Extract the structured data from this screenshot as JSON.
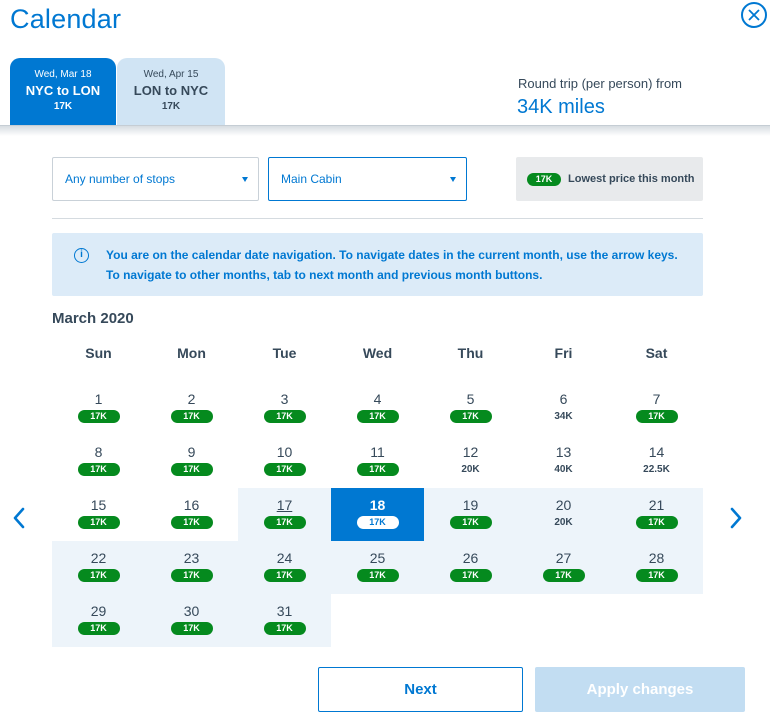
{
  "header": {
    "title": "Calendar",
    "tabs": [
      {
        "date": "Wed, Mar 18",
        "route": "NYC to LON",
        "price": "17K"
      },
      {
        "date": "Wed, Apr 15",
        "route": "LON to NYC",
        "price": "17K"
      }
    ],
    "trip_label": "Round trip (per person) from",
    "trip_price": "34K miles"
  },
  "filters": {
    "stops": "Any number of stops",
    "cabin": "Main Cabin",
    "lowest_badge": "17K",
    "lowest_label": "Lowest price this month"
  },
  "info": "You are on the calendar date navigation. To navigate dates in the current month, use the arrow keys. To navigate to other months, tab to next month and previous month buttons.",
  "calendar": {
    "month": "March 2020",
    "weekdays": [
      "Sun",
      "Mon",
      "Tue",
      "Wed",
      "Thu",
      "Fri",
      "Sat"
    ],
    "days": [
      {
        "d": "1",
        "p": "17K",
        "low": true
      },
      {
        "d": "2",
        "p": "17K",
        "low": true
      },
      {
        "d": "3",
        "p": "17K",
        "low": true
      },
      {
        "d": "4",
        "p": "17K",
        "low": true
      },
      {
        "d": "5",
        "p": "17K",
        "low": true
      },
      {
        "d": "6",
        "p": "34K",
        "low": false
      },
      {
        "d": "7",
        "p": "17K",
        "low": true
      },
      {
        "d": "8",
        "p": "17K",
        "low": true
      },
      {
        "d": "9",
        "p": "17K",
        "low": true
      },
      {
        "d": "10",
        "p": "17K",
        "low": true
      },
      {
        "d": "11",
        "p": "17K",
        "low": true
      },
      {
        "d": "12",
        "p": "20K",
        "low": false
      },
      {
        "d": "13",
        "p": "40K",
        "low": false
      },
      {
        "d": "14",
        "p": "22.5K",
        "low": false
      },
      {
        "d": "15",
        "p": "17K",
        "low": true
      },
      {
        "d": "16",
        "p": "17K",
        "low": true
      },
      {
        "d": "17",
        "p": "17K",
        "low": true
      },
      {
        "d": "18",
        "p": "17K",
        "low": true
      },
      {
        "d": "19",
        "p": "17K",
        "low": true
      },
      {
        "d": "20",
        "p": "20K",
        "low": false
      },
      {
        "d": "21",
        "p": "17K",
        "low": true
      },
      {
        "d": "22",
        "p": "17K",
        "low": true
      },
      {
        "d": "23",
        "p": "17K",
        "low": true
      },
      {
        "d": "24",
        "p": "17K",
        "low": true
      },
      {
        "d": "25",
        "p": "17K",
        "low": true
      },
      {
        "d": "26",
        "p": "17K",
        "low": true
      },
      {
        "d": "27",
        "p": "17K",
        "low": true
      },
      {
        "d": "28",
        "p": "17K",
        "low": true
      },
      {
        "d": "29",
        "p": "17K",
        "low": true
      },
      {
        "d": "30",
        "p": "17K",
        "low": true
      },
      {
        "d": "31",
        "p": "17K",
        "low": true
      }
    ],
    "selected_day": "18",
    "today": "17",
    "range_days": [
      "17",
      "19",
      "20",
      "21",
      "22",
      "23",
      "24",
      "25",
      "26",
      "27",
      "28",
      "29",
      "30",
      "31"
    ]
  },
  "buttons": {
    "next": "Next",
    "apply": "Apply changes"
  },
  "colors": {
    "accent": "#0078d2",
    "price_green": "#058a1e",
    "range_bg": "#edf4fa"
  }
}
